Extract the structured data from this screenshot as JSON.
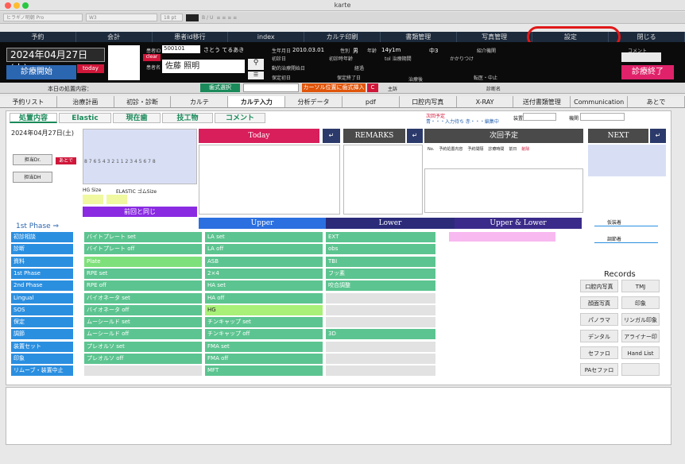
{
  "window": {
    "title": "karte"
  },
  "toolbar": {
    "font": "ヒラギノ明朝 Pro",
    "style": "W3",
    "size": "18 pt"
  },
  "top_nav": [
    "予約",
    "会計",
    "患者id移行",
    "index",
    "カルテ印刷",
    "書類管理",
    "写真管理",
    "設定",
    "閉じる"
  ],
  "header": {
    "date": "2024年04月27日(土)",
    "start_button": "診療開始",
    "today_button": "today",
    "patient_id_label": "患者ID",
    "patient_id": "500101",
    "kana": "さとう てるあき",
    "clear": "clear",
    "name_label": "患者名",
    "patient_name": "佐藤 照明",
    "birth_label": "生年月日",
    "birth": "2010.03.01",
    "sex_label": "性別",
    "sex": "男",
    "age_label": "年齢",
    "age": "14y1m",
    "grade": "中3",
    "intro_label": "紹介機関",
    "first_label": "初診日",
    "first_age": "初診時年齢",
    "treat_period": "tol 治療期間",
    "family": "かかりつけ",
    "start_date": "動的治療開始日",
    "elapsed": "経過",
    "retention": "保定初日",
    "retention_end": "保定終了日",
    "post": "治療後",
    "transfer": "転医・中止",
    "comment_label": "コメント",
    "end_button": "診療終了",
    "main_label": "主訴",
    "region": "診断名",
    "admin": "admin"
  },
  "row1": {
    "today_content": "本日の処置内容：",
    "format_select": "歯式選択",
    "cursor_insert": "カーソル位置に歯式挿入",
    "c_button": "C"
  },
  "tabs": [
    "予約リスト",
    "治療計画",
    "初診・診断",
    "カルテ",
    "カルテ入力",
    "分析データ",
    "pdf",
    "口腔内写真",
    "X-RAY",
    "送付書類管理",
    "Communication",
    "あとで"
  ],
  "active_tab": "カルテ入力",
  "sub_tabs": [
    "処置内容",
    "Elastic",
    "現在歯",
    "技工物",
    "コメント"
  ],
  "next_info": {
    "line1": "次回予定",
    "line2": "青・・・入力待ち  赤・・・編集中",
    "device": "装置",
    "period": "機関"
  },
  "left": {
    "date": "2024年04月27日(土)",
    "dr": "担当Dr.",
    "later": "あとで",
    "dh": "担当DH",
    "teeth": "8 7 6 5 4 3 2 1  1 2 3 4 5 6 7 8",
    "hg": "HG Size",
    "elastic": "ELASTIC ゴムSize",
    "same": "前回と同じ"
  },
  "columns": {
    "today": "Today",
    "remarks": "REMARKS",
    "next": "次回予定",
    "next2": "NEXT"
  },
  "next_table": [
    "No.",
    "予約処置内容",
    "予約間隔",
    "診療時間",
    "前日",
    "削除"
  ],
  "phase": {
    "label": "1st Phase ⇒",
    "upper": "Upper",
    "lower": "Lower",
    "ul": "Upper & Lower"
  },
  "categories": [
    "初診相談",
    "診断",
    "資料",
    "1st Phase",
    "2nd Phase",
    "Lingual",
    "SOS",
    "保定",
    "調節",
    "装置セット",
    "印象",
    "リムーブ・装置中止"
  ],
  "list1": [
    "バイトプレート set",
    "バイトプレート off",
    "Plate",
    "RPE set",
    "RPE off",
    "バイオネータ set",
    "バイオネータ off",
    "ムーシールド set",
    "ムーシールド off",
    "プレオルソ set",
    "プレオルソ off",
    ""
  ],
  "list2": [
    "LA set",
    "LA off",
    "ASB",
    "2×4",
    "HA set",
    "HA off",
    "HG",
    "チンキャップ set",
    "チンキャップ off",
    "FMA set",
    "FMA off",
    "MFT"
  ],
  "list3": [
    "EXT",
    "obs",
    "TBI",
    "フッ素",
    "咬合調整",
    "",
    "",
    "",
    "3D",
    "",
    "",
    ""
  ],
  "right": {
    "r1": "仮装着",
    "r2": "調節着",
    "records": "Records",
    "items": [
      "口腔内写真",
      "TMJ",
      "顔面写真",
      "印象",
      "パノラマ",
      "リンガル印象",
      "デンタル",
      "アライナー印象",
      "セファロ",
      "Hand List",
      "PAセファロ",
      ""
    ]
  }
}
